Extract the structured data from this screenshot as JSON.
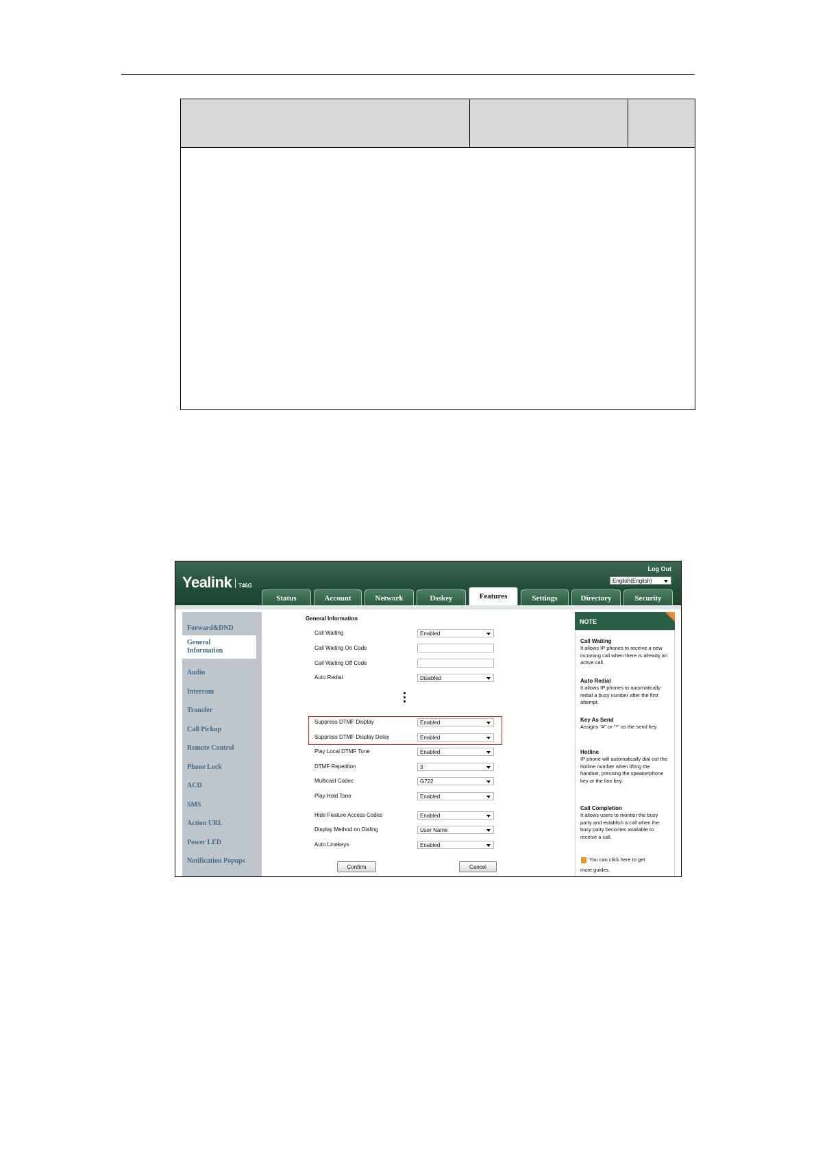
{
  "screenshot": {
    "brand": "Yealink",
    "model": "T46G",
    "logout_label": "Log Out",
    "language_value": "English(English)",
    "tabs": [
      "Status",
      "Account",
      "Network",
      "Dsskey",
      "Features",
      "Settings",
      "Directory",
      "Security"
    ],
    "active_tab": "Features",
    "sidebar": {
      "items": [
        "Forward&DND",
        "General Information",
        "Audio",
        "Intercom",
        "Transfer",
        "Call Pickup",
        "Remote Control",
        "Phone Lock",
        "ACD",
        "SMS",
        "Action URL",
        "Power LED",
        "Notification Popups"
      ],
      "active_line1": "General",
      "active_line2": "Information"
    },
    "form": {
      "section_title": "General Information",
      "call_waiting": {
        "label": "Call Waiting",
        "value": "Enabled"
      },
      "call_waiting_on_code": {
        "label": "Call Waiting On Code",
        "value": ""
      },
      "call_waiting_off_code": {
        "label": "Call Waiting Off Code",
        "value": ""
      },
      "auto_redial": {
        "label": "Auto Redial",
        "value": "Disabled"
      },
      "suppress_dtmf_display": {
        "label": "Suppress DTMF Display",
        "value": "Enabled"
      },
      "suppress_dtmf_display_delay": {
        "label": "Suppress DTMF Display Delay",
        "value": "Enabled"
      },
      "play_local_dtmf_tone": {
        "label": "Play Local DTMF Tone",
        "value": "Enabled"
      },
      "dtmf_repetition": {
        "label": "DTMF Repetition",
        "value": "3"
      },
      "multicast_codec": {
        "label": "Multicast Codec",
        "value": "G722"
      },
      "play_hold_tone": {
        "label": "Play Hold Tone",
        "value": "Enabled"
      },
      "hide_feature_access_codes": {
        "label": "Hide Feature Access Codes",
        "value": "Enabled"
      },
      "display_method_on_dialing": {
        "label": "Display Method on Dialing",
        "value": "User Name"
      },
      "auto_linekeys": {
        "label": "Auto Linekeys",
        "value": "Enabled"
      },
      "confirm_label": "Confirm",
      "cancel_label": "Cancel"
    },
    "note": {
      "title": "NOTE",
      "entries": [
        {
          "title": "Call Waiting",
          "body": "It allows IP phones to receive a new incoming call when there is already an active call."
        },
        {
          "title": "Auto Redial",
          "body": "It allows IP phones to automatically redial a busy number after the first attempt."
        },
        {
          "title": "Key As Send",
          "body": "Assigns \"#\" or \"*\" as the send key."
        },
        {
          "title": "Hotline",
          "body": "IP phone will automatically dial out the hotline number when lifting the handset, pressing the speakerphone key or the line key."
        },
        {
          "title": "Call Completion",
          "body": "It allows users to monitor the busy party and establish a call when the busy party becomes available to receive a call."
        }
      ],
      "guide_line1": "You can click here to get",
      "guide_line2": "more guides."
    }
  }
}
